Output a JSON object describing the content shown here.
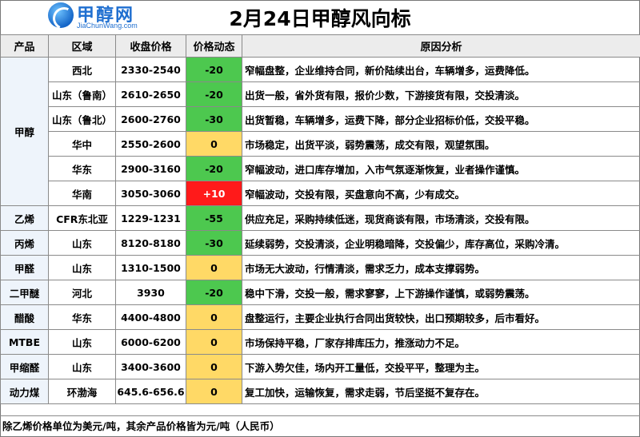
{
  "logo": {
    "name": "甲醇网",
    "sub": "JiaChunWang.com"
  },
  "title": "2月24日甲醇风向标",
  "headers": [
    "产品",
    "区域",
    "收盘价格",
    "价格动态",
    "原因分析"
  ],
  "rows": [
    {
      "product": "甲醇",
      "region": "西北",
      "price": "2330-2540",
      "change": "-20",
      "trend": "down",
      "reason": "窄幅盘整，企业维持合同，新价陆续出台，车辆增多，运费降低。"
    },
    {
      "product": "",
      "region": "山东（鲁南）",
      "price": "2610-2650",
      "change": "-20",
      "trend": "down",
      "reason": "出货一般，省外货有限，报价少数，下游接货有限，交投清淡。"
    },
    {
      "product": "",
      "region": "山东（鲁北）",
      "price": "2600-2760",
      "change": "-30",
      "trend": "down",
      "reason": "出货暂稳，车辆增多，运费下降，部分企业招标价低，交投平稳。"
    },
    {
      "product": "",
      "region": "华中",
      "price": "2550-2600",
      "change": "0",
      "trend": "flat",
      "reason": "市场稳定，出货平淡，弱势震荡，成交有限，观望氛围。"
    },
    {
      "product": "",
      "region": "华东",
      "price": "2900-3160",
      "change": "-20",
      "trend": "down",
      "reason": "窄幅波动，进口库存增加，入市气氛逐渐恢复，业者操作谨慎。"
    },
    {
      "product": "",
      "region": "华南",
      "price": "3050-3060",
      "change": "+10",
      "trend": "up",
      "reason": "窄幅波动，交投有限，买盘意向不高，少有成交。"
    },
    {
      "product": "乙烯",
      "region": "CFR东北亚",
      "price": "1229-1231",
      "change": "-55",
      "trend": "down",
      "reason": "供应充足，采购持续低迷，现货商谈有限，市场清淡，交投有限。"
    },
    {
      "product": "丙烯",
      "region": "山东",
      "price": "8120-8180",
      "change": "-30",
      "trend": "down",
      "reason": "延续弱势，交投清淡，企业明稳暗降，交投偏少，库存高位，采购冷清。"
    },
    {
      "product": "甲醛",
      "region": "山东",
      "price": "1310-1500",
      "change": "0",
      "trend": "flat",
      "reason": "市场无大波动，行情清淡，需求乏力，成本支撑弱势。"
    },
    {
      "product": "二甲醚",
      "region": "河北",
      "price": "3930",
      "change": "-20",
      "trend": "down",
      "reason": "稳中下滑，交投一般，需求寥寥，上下游操作谨慎，或弱势震荡。"
    },
    {
      "product": "醋酸",
      "region": "华东",
      "price": "4400-4800",
      "change": "0",
      "trend": "flat",
      "reason": "盘整运行，主要企业执行合同出货较快，出口预期较多，后市看好。"
    },
    {
      "product": "MTBE",
      "region": "山东",
      "price": "6000-6200",
      "change": "0",
      "trend": "flat",
      "reason": "市场保持平稳，厂家存排库压力，推涨动力不足。"
    },
    {
      "product": "甲缩醛",
      "region": "山东",
      "price": "3400-3600",
      "change": "0",
      "trend": "flat",
      "reason": "下游入势欠佳，场内开工量低，交投平平，整理为主。"
    },
    {
      "product": "动力煤",
      "region": "环渤海",
      "price": "645.6-656.6",
      "change": "0",
      "trend": "flat",
      "reason": "复工加快，运输恢复，需求走弱，节后坚挺不复存在。"
    }
  ],
  "footnote": "除乙烯价格单位为美元/吨，其余产品价格皆为元/吨（人民币）",
  "colors": {
    "down": "#4dc84f",
    "flat": "#ffd966",
    "up": "#ff1a1a"
  }
}
